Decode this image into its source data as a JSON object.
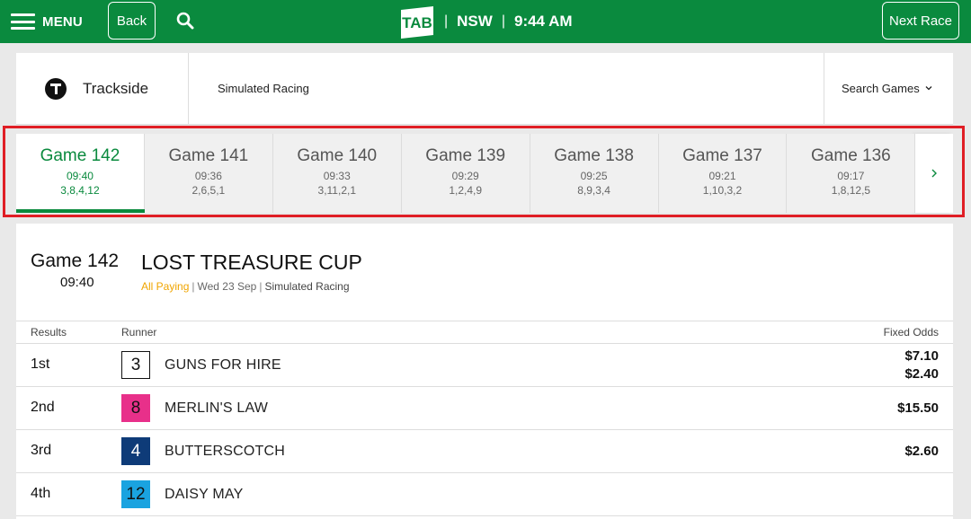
{
  "topbar": {
    "menu_label": "MENU",
    "back_label": "Back",
    "logo_text": "TAB",
    "separator": "|",
    "state": "NSW",
    "time": "9:44 AM",
    "next_race_label": "Next Race",
    "bg_color": "#0a8a3e"
  },
  "header": {
    "brand": "Trackside",
    "section": "Simulated Racing",
    "search_games": "Search Games"
  },
  "games": [
    {
      "name": "Game 142",
      "time": "09:40",
      "results": "3,8,4,12",
      "active": true
    },
    {
      "name": "Game 141",
      "time": "09:36",
      "results": "2,6,5,1"
    },
    {
      "name": "Game 140",
      "time": "09:33",
      "results": "3,11,2,1"
    },
    {
      "name": "Game 139",
      "time": "09:29",
      "results": "1,2,4,9"
    },
    {
      "name": "Game 138",
      "time": "09:25",
      "results": "8,9,3,4"
    },
    {
      "name": "Game 137",
      "time": "09:21",
      "results": "1,10,3,2"
    },
    {
      "name": "Game 136",
      "time": "09:17",
      "results": "1,8,12,5"
    }
  ],
  "race": {
    "game": "Game 142",
    "time": "09:40",
    "title": "LOST TREASURE CUP",
    "status": "All Paying",
    "date": "Wed 23 Sep",
    "category": "Simulated Racing",
    "sep": "|"
  },
  "table": {
    "headers": {
      "results": "Results",
      "runner": "Runner",
      "odds": "Fixed Odds"
    },
    "rows": [
      {
        "position": "1st",
        "number": "3",
        "runner": "GUNS FOR HIRE",
        "odds": [
          "$7.10",
          "$2.40"
        ],
        "num_bg": "#ffffff",
        "num_fg": "#111111",
        "num_border": "#111111"
      },
      {
        "position": "2nd",
        "number": "8",
        "runner": "MERLIN'S LAW",
        "odds": [
          "$15.50"
        ],
        "num_bg": "#e8308a",
        "num_fg": "#111111",
        "num_border": "#e8308a"
      },
      {
        "position": "3rd",
        "number": "4",
        "runner": "BUTTERSCOTCH",
        "odds": [
          "$2.60"
        ],
        "num_bg": "#0e3b78",
        "num_fg": "#ffffff",
        "num_border": "#0e3b78"
      },
      {
        "position": "4th",
        "number": "12",
        "runner": "DAISY MAY",
        "odds": [],
        "num_bg": "#1aa3e0",
        "num_fg": "#111111",
        "num_border": "#1aa3e0"
      }
    ]
  }
}
